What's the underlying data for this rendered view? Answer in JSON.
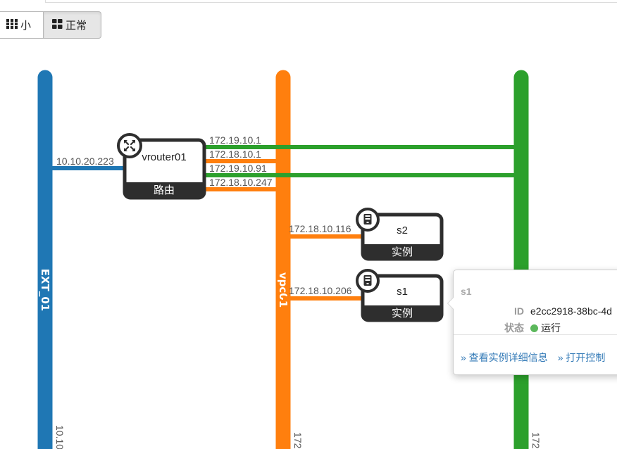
{
  "view_toggle": {
    "small_icon": "grid-small-icon",
    "small_label": "小",
    "normal_icon": "grid-normal-icon",
    "normal_label": "正常",
    "active": "正常"
  },
  "networks": [
    {
      "name": "EXT_01",
      "color": "#1f77b4",
      "subnet_label": "10.10"
    },
    {
      "name": "vpc01",
      "color": "#ff7f0e",
      "subnet_label": "172"
    },
    {
      "name": "",
      "color": "#2ca02c",
      "subnet_label": "172"
    }
  ],
  "router": {
    "name": "vrouter01",
    "type_label": "路由",
    "icon": "router-icon",
    "ext_ip": "10.10.20.223",
    "ports": [
      {
        "ip": "172.19.10.1",
        "network_color": "#2ca02c"
      },
      {
        "ip": "172.18.10.1",
        "network_color": "#ff7f0e"
      },
      {
        "ip": "172.19.10.91",
        "network_color": "#2ca02c"
      },
      {
        "ip": "172.18.10.247",
        "network_color": "#ff7f0e"
      }
    ]
  },
  "instances": [
    {
      "name": "s2",
      "type_label": "实例",
      "icon": "server-icon",
      "ip": "172.18.10.116"
    },
    {
      "name": "s1",
      "type_label": "实例",
      "icon": "server-icon",
      "ip": "172.18.10.206"
    }
  ],
  "popup": {
    "title": "s1",
    "id_label": "ID",
    "id_value": "e2cc2918-38bc-4d",
    "status_label": "状态",
    "status_value": "运行",
    "status_color": "#5cb85c",
    "link_details": "» 查看实例详细信息",
    "link_console": "» 打开控制"
  }
}
